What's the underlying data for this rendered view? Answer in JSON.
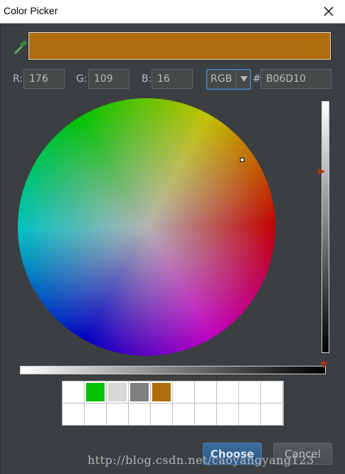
{
  "window": {
    "title": "Color Picker"
  },
  "preview": {
    "color": "#B06D10"
  },
  "fields": {
    "r": {
      "label": "R:",
      "value": "176"
    },
    "g": {
      "label": "G:",
      "value": "109"
    },
    "b": {
      "label": "B:",
      "value": "16"
    },
    "mode": {
      "selected": "RGB"
    },
    "hex": {
      "label": "#",
      "value": "B06D10"
    }
  },
  "brightness": {
    "level": 0.72
  },
  "opacity": {
    "level": 1.0
  },
  "recent_colors": [
    "#ffffff",
    "#00c000",
    "#d8d8d8",
    "#808080",
    "#b06d10",
    "#ffffff",
    "#ffffff",
    "#ffffff",
    "#ffffff",
    "#ffffff",
    "#ffffff",
    "#ffffff",
    "#ffffff",
    "#ffffff",
    "#ffffff",
    "#ffffff",
    "#ffffff",
    "#ffffff",
    "#ffffff",
    "#ffffff"
  ],
  "buttons": {
    "choose": "Choose",
    "cancel": "Cancel"
  },
  "watermark": "http://blog.csdn.net/caoyangyang123",
  "icons": {
    "picker": "eyedropper-icon",
    "close": "close-icon",
    "dropdown": "dropdown-arrow-icon"
  }
}
